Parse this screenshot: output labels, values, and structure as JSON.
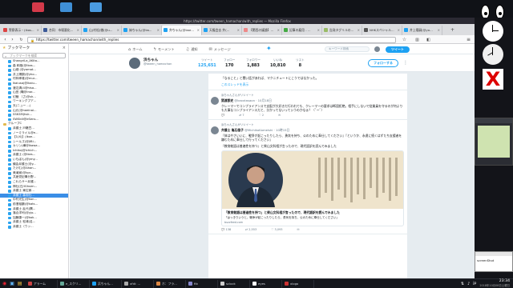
{
  "window": {
    "title": "https://twitter.com/tween_hamachan/with_replies — Mozilla Firefox"
  },
  "tabs": [
    {
      "label": "警察表示・(Ikas..."
    },
    {
      "label": "合同：市場悪化..."
    },
    {
      "label": "山(村松)徹(@u..."
    },
    {
      "label": "妹ちゃん(@tw..."
    },
    {
      "label": "弁ちゃん(@twe...",
      "active": true
    },
    {
      "label": "天権会去 弁(…"
    },
    {
      "label": "【関西の議論】…"
    },
    {
      "label": "記事の雇用 - …"
    },
    {
      "label": "告発タグリルの…"
    },
    {
      "label": "NHKスペシャル…"
    },
    {
      "label": "井上陽嗣(@yo…"
    }
  ],
  "nav": {
    "url": "https://twitter.com/tween_hamachan/with_replies",
    "search_placeholder": "キーワード検索"
  },
  "sidebar": {
    "title": "ブックマーク",
    "search_placeholder": "ブックマークを検索",
    "items": [
      {
        "label": "ShangriLa_AKita..."
      },
      {
        "label": "森 和雄(@Ikas..."
      },
      {
        "label": "山畑 (@yamat..."
      },
      {
        "label": "井上陽嗣(@yho..."
      },
      {
        "label": "村林孝雄(@mur..."
      },
      {
        "label": "Ikaiusa(@Ikaiu..."
      },
      {
        "label": "渡辺清(4@hisa..."
      },
      {
        "label": "山田 (職@Inor..."
      },
      {
        "label": "幻魅 （さ(@sh..."
      },
      {
        "label": "ワーキングプア..."
      },
      {
        "label": "天(ニュー ...)"
      },
      {
        "label": "山元(@naeinai..."
      },
      {
        "label": "SSKSM(hsk..."
      },
      {
        "label": "SWSkill@eSens..."
      },
      {
        "label": "グループC",
        "folder": true
      },
      {
        "label": "弁護士 戸籍豆..."
      },
      {
        "label": "ノーミライル@e..."
      },
      {
        "label": "【1(X)】(Ikoe..."
      },
      {
        "label": "シールズ(@JIBi..."
      },
      {
        "label": "カリン(横@Ikawa..."
      },
      {
        "label": "Ichiko(@ichich..."
      },
      {
        "label": "弁護士 (@Ikes..."
      },
      {
        "label": "いもぽん(@ymy..."
      },
      {
        "label": "議会弁護士(@y..."
      },
      {
        "label": "たけむ(@Ahan..."
      },
      {
        "label": "美滝家(@kpr..."
      },
      {
        "label": "共産党記事分野..."
      },
      {
        "label": "これらサー弁護..."
      },
      {
        "label": "神社(日/IGhsim..."
      },
      {
        "label": "弁護士 東辺家..."
      },
      {
        "label": "弁護士 森泡社...",
        "selected": true
      },
      {
        "label": "中村光生(@kon..."
      },
      {
        "label": "前澄裕鶴(@kats..."
      },
      {
        "label": "弁護士 乱代(隅..."
      },
      {
        "label": "落合洋司(@yjo..."
      },
      {
        "label": "加藤康一(@kok..."
      },
      {
        "label": "弁護士 松浦(名..."
      },
      {
        "label": "弁護士（ウッ..."
      }
    ]
  },
  "twitter": {
    "nav_items": [
      {
        "label": "ホーム",
        "icon": "home-icon"
      },
      {
        "label": "モーメント",
        "icon": "lightning-icon"
      },
      {
        "label": "通知",
        "icon": "bell-icon"
      },
      {
        "label": "メッセージ",
        "icon": "mail-icon"
      }
    ],
    "search_placeholder": "キーワード検索",
    "tweet_button": "ツイート",
    "profile": {
      "name": "浜ちゃん",
      "handle": "@tween_hamachan"
    },
    "stats": [
      {
        "label": "ツイート",
        "value": "125,651",
        "active": true
      },
      {
        "label": "フォロー",
        "value": "170"
      },
      {
        "label": "フォロワー",
        "value": "1,883"
      },
      {
        "label": "いいね",
        "value": "10,810"
      },
      {
        "label": "リスト",
        "value": "8"
      }
    ],
    "follow_button": "フォローする",
    "tweets": [
      {
        "body": "「なること」と聞い話があれば、マクニチュートにこうではなかった。",
        "link": "このスレッドを表示"
      },
      {
        "retweet": "浜ちゃんさんがリツイート",
        "name": "猿渡郡史",
        "handle": "@kaxxtasaon · 10月18日",
        "body": "クレーマーでコンプライアンスで支配が大好きだ行われても、クレーマーの要求は断固拒絶。相手にしないで従業員を守るのが何よりも大事なコンプライアンスだと、分かってないっていうのかなぁ？（ﾟーﾟ）",
        "actions": [
          "",
          "7",
          "2"
        ]
      },
      {
        "retweet": "浜ちゃんさんがリツイート",
        "name": "弁護士 亀石倫子",
        "handle": "@MichikoKameishi · 10時15日",
        "body": "『体はやさいいに、戦争が起こったりしたら、勇気を持ち、公のために奉仕してください』『というか、永遠に続くはずたち支援者を嫌むために奉仕して行ってください』",
        "body2": "『教育勅語は普遍性を持つ』と柴山文科相が言ったので、現代語訳を読んでみました",
        "card_title": "「教育勅語は普遍性を持つ」と柴山文科相が言ったので、現代語訳を読んでみました",
        "card_desc": "「はっきりいうと、戦争が起こったりしたら、勇気を持ち、公のために奉仕してください」",
        "card_url": "buzzfeed.com",
        "actions": [
          "138",
          "2,553",
          "3,093"
        ]
      }
    ]
  },
  "taskbar": {
    "items": [
      {
        "label": "アラーム"
      },
      {
        "label": "e_スクリ..."
      },
      {
        "label": "浜ちゃん..."
      },
      {
        "label": "xfdi: ..."
      },
      {
        "label": "ホ：フラ..."
      },
      {
        "label": "ftk"
      },
      {
        "label": "sclock"
      },
      {
        "label": "eyes"
      },
      {
        "label": "xlogo"
      }
    ],
    "clock_time": "23:34",
    "clock_date": "2018年10月08日土曜日",
    "ime": "jp"
  },
  "desktop": {
    "mini_window_label": "screenShot"
  }
}
